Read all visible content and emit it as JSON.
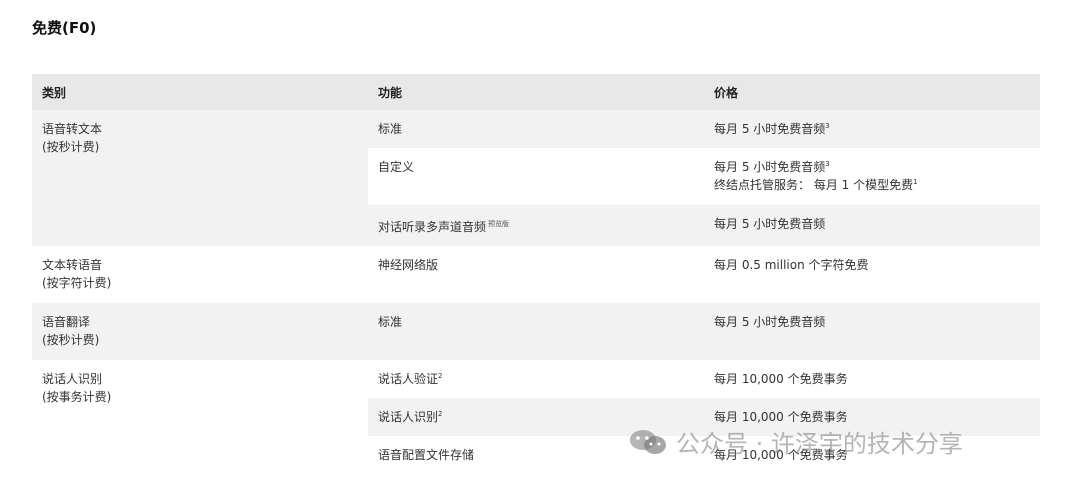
{
  "title": "免费(F0)",
  "headers": [
    "类别",
    "功能",
    "价格"
  ],
  "rows": [
    {
      "cat1": "语音转文本",
      "cat2": "(按秒计费)",
      "feature": "标准",
      "feature_tag": "",
      "price1": "每月 5 小时免费音频",
      "price1_sup": "3",
      "price2": "",
      "price2_sup": ""
    },
    {
      "cat1": "",
      "cat2": "",
      "feature": "自定义",
      "feature_tag": "",
      "price1": "每月 5 小时免费音频",
      "price1_sup": "3",
      "price2": "终结点托管服务： 每月 1 个模型免费",
      "price2_sup": "1"
    },
    {
      "cat1": "",
      "cat2": "",
      "feature": "对话听录多声道音频",
      "feature_tag": "预览版",
      "price1": "每月 5 小时免费音频",
      "price1_sup": "",
      "price2": "",
      "price2_sup": ""
    },
    {
      "cat1": "文本转语音",
      "cat2": "(按字符计费)",
      "feature": "神经网络版",
      "feature_tag": "",
      "price1": "每月 0.5 million 个字符免费",
      "price1_sup": "",
      "price2": "",
      "price2_sup": ""
    },
    {
      "cat1": "语音翻译",
      "cat2": "(按秒计费)",
      "feature": "标准",
      "feature_tag": "",
      "price1": "每月 5 小时免费音频",
      "price1_sup": "",
      "price2": "",
      "price2_sup": ""
    },
    {
      "cat1": "说话人识别",
      "cat2": "(按事务计费)",
      "feature": "说话人验证",
      "feature_tag": "",
      "feature_sup": "2",
      "price1": "每月 10,000 个免费事务",
      "price1_sup": "",
      "price2": "",
      "price2_sup": ""
    },
    {
      "cat1": "",
      "cat2": "",
      "feature": "说话人识别",
      "feature_tag": "",
      "feature_sup": "2",
      "price1": "每月 10,000 个免费事务",
      "price1_sup": "",
      "price2": "",
      "price2_sup": ""
    },
    {
      "cat1": "",
      "cat2": "",
      "feature": "语音配置文件存储",
      "feature_tag": "",
      "price1": "每月 10,000 个免费事务",
      "price1_sup": "",
      "price2": "",
      "price2_sup": ""
    }
  ],
  "watermark": "公众号 · 许泽宇的技术分享",
  "icons": {
    "watermark_logo": "wechat-icon"
  }
}
